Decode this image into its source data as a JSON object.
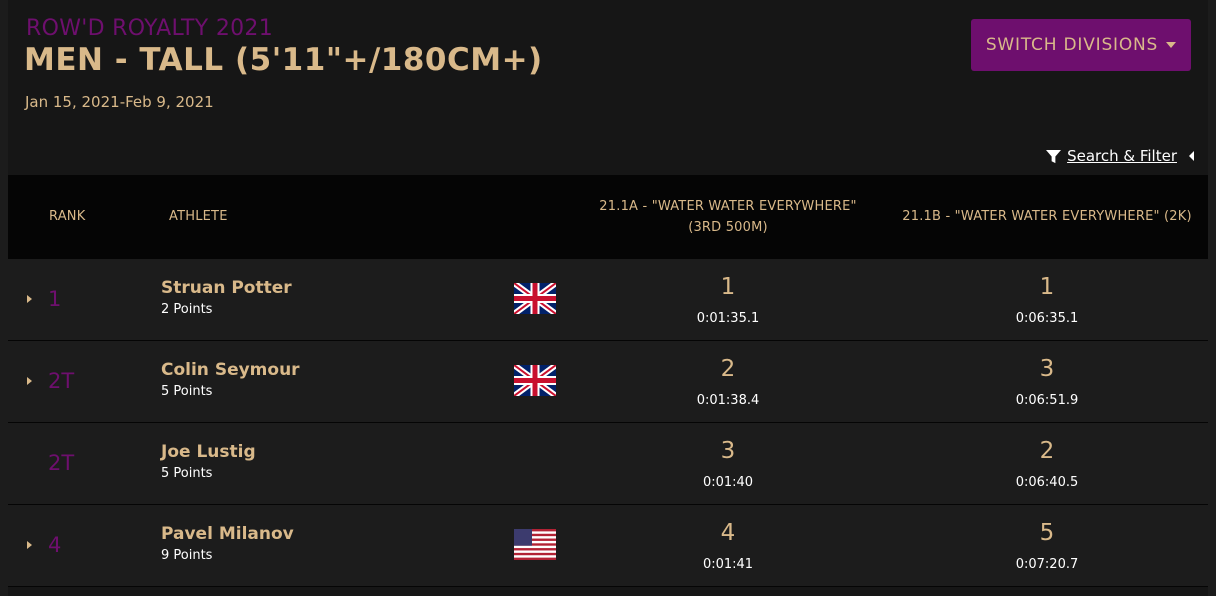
{
  "header": {
    "event_name": "ROW'D ROYALTY 2021",
    "division_title": "MEN - TALL (5'11\"+/180CM+)",
    "date_range": "Jan 15, 2021-Feb 9, 2021",
    "switch_label": "SWITCH DIVISIONS",
    "filter_label": "Search & Filter"
  },
  "table": {
    "columns": {
      "rank": "RANK",
      "athlete": "ATHLETE",
      "event1_line1": "21.1A - \"WATER WATER EVERYWHERE\"",
      "event1_line2": "(3RD 500M)",
      "event2": "21.1B - \"WATER WATER EVERYWHERE\" (2K)"
    },
    "rows": [
      {
        "rank": "1",
        "name": "Struan Potter",
        "points": "2 Points",
        "flag": "uk-flag",
        "e1_rank": "1",
        "e1_time": "0:01:35.1",
        "e2_rank": "1",
        "e2_time": "0:06:35.1"
      },
      {
        "rank": "2T",
        "name": "Colin Seymour",
        "points": "5 Points",
        "flag": "uk-flag",
        "e1_rank": "2",
        "e1_time": "0:01:38.4",
        "e2_rank": "3",
        "e2_time": "0:06:51.9"
      },
      {
        "rank": "2T",
        "name": "Joe Lustig",
        "points": "5 Points",
        "flag": "",
        "e1_rank": "3",
        "e1_time": "0:01:40",
        "e2_rank": "2",
        "e2_time": "0:06:40.5"
      },
      {
        "rank": "4",
        "name": "Pavel Milanov",
        "points": "9 Points",
        "flag": "us-flag",
        "e1_rank": "4",
        "e1_time": "0:01:41",
        "e2_rank": "5",
        "e2_time": "0:07:20.7"
      }
    ]
  },
  "colors": {
    "accent_purple": "#6e0f6e",
    "gold": "#d9b98a",
    "background": "#161616"
  }
}
